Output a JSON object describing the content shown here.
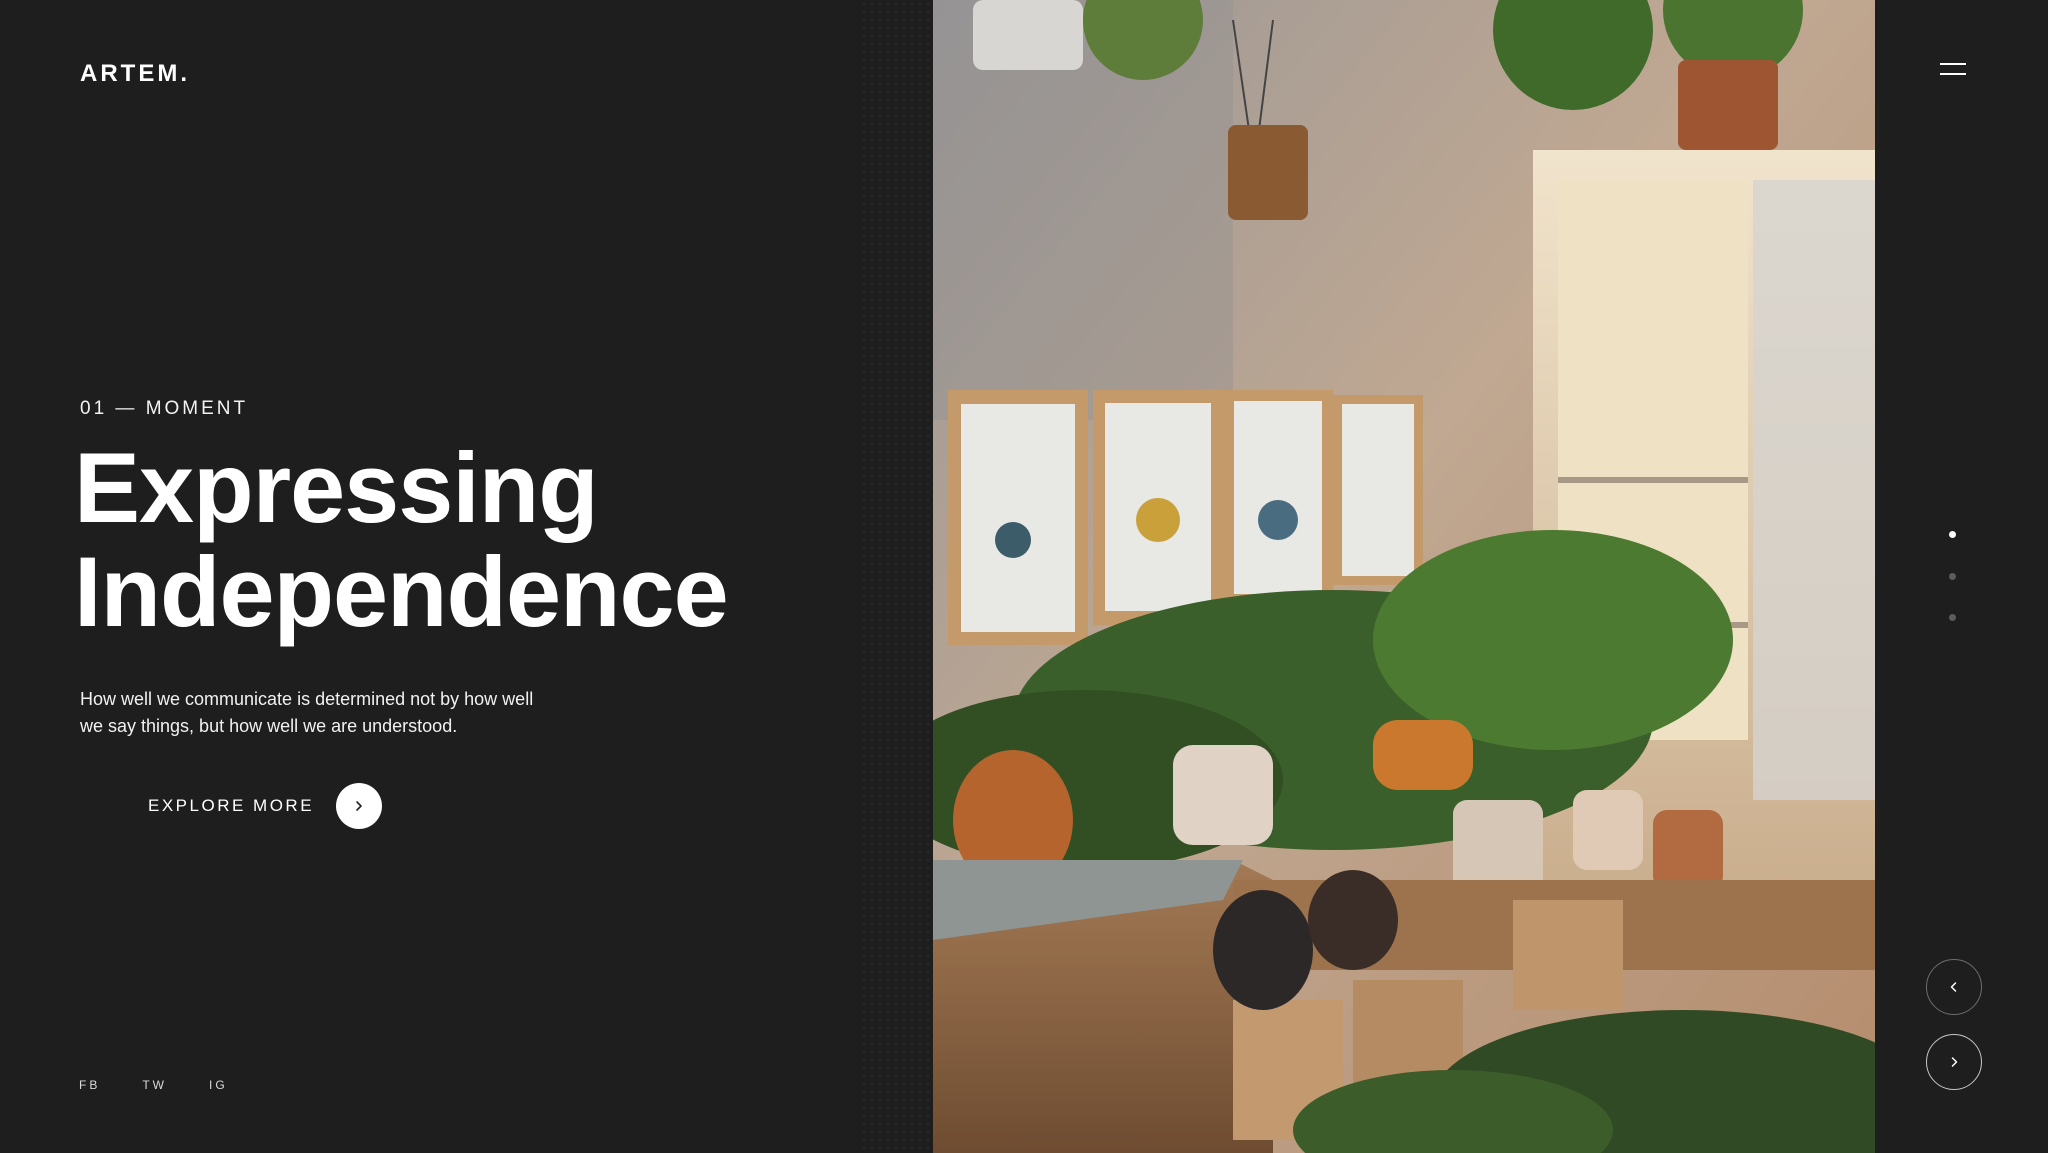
{
  "brand": {
    "logo": "ARTEM."
  },
  "hero": {
    "eyebrow": "01 — MOMENT",
    "headline_line1": "Expressing",
    "headline_line2": "Independence",
    "description": "How well we communicate is determined not by how well we say things, but how well we are understood.",
    "cta_label": "EXPLORE MORE"
  },
  "social": [
    {
      "label": "FB"
    },
    {
      "label": "TW"
    },
    {
      "label": "IG"
    }
  ],
  "slider": {
    "total": 3,
    "active_index": 0
  },
  "icons": {
    "menu": "hamburger-menu-icon",
    "cta": "chevron-right-icon",
    "prev": "chevron-left-icon",
    "next": "chevron-right-icon"
  },
  "colors": {
    "background": "#1f1e1f",
    "text": "#ffffff",
    "dot_inactive": "#5c5c5c"
  }
}
